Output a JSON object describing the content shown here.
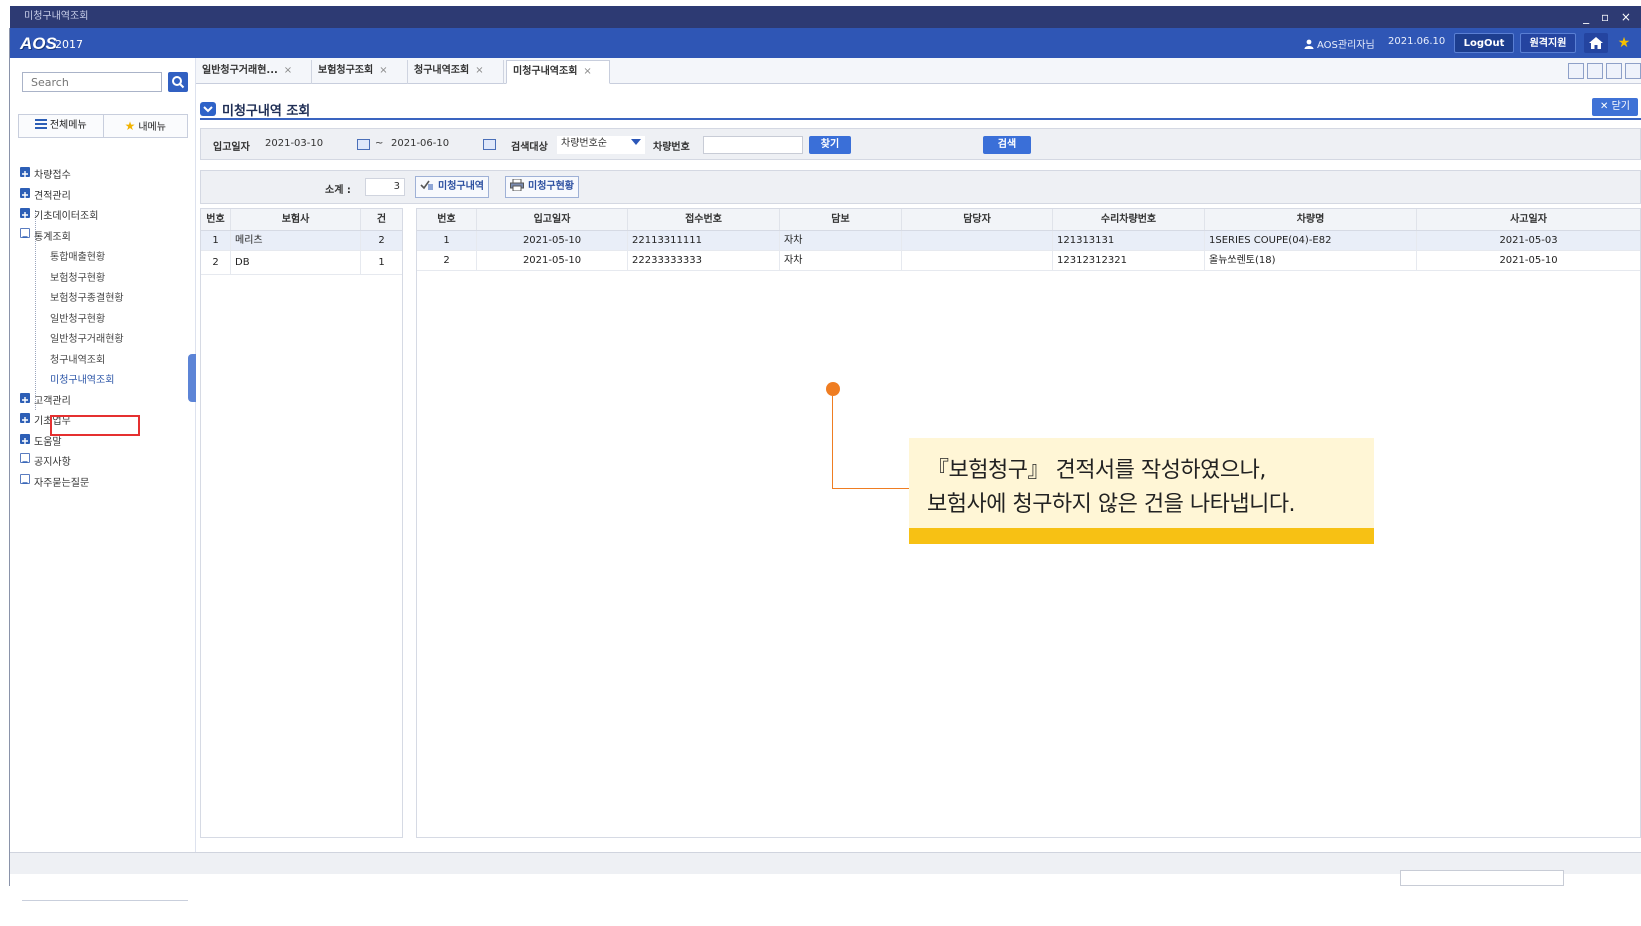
{
  "window": {
    "title": "미청구내역조회",
    "controls": "_ ▫ ×"
  },
  "appbar": {
    "logo": "AOS",
    "logo_year": "2017",
    "user": "AOS관리자님",
    "date": "2021.06.10",
    "logout_label": "LogOut",
    "remote_label": "원격지원"
  },
  "sidebar": {
    "search_placeholder": "Search",
    "menu_tab_all": "전체메뉴",
    "menu_tab_my": "내메뉴",
    "tree": [
      {
        "label": "차량접수",
        "type": "plus"
      },
      {
        "label": "견적관리",
        "type": "plus"
      },
      {
        "label": "기초데이터조회",
        "type": "plus"
      },
      {
        "label": "통계조회",
        "type": "minus"
      },
      {
        "label": "통합매출현황",
        "type": "child"
      },
      {
        "label": "보험청구현황",
        "type": "child"
      },
      {
        "label": "보험청구종결현황",
        "type": "child"
      },
      {
        "label": "일반청구현황",
        "type": "child"
      },
      {
        "label": "일반청구거래현황",
        "type": "child"
      },
      {
        "label": "청구내역조회",
        "type": "child"
      },
      {
        "label": "미청구내역조회",
        "type": "child-selected"
      },
      {
        "label": "고객관리",
        "type": "plus"
      },
      {
        "label": "기초업무",
        "type": "plus"
      },
      {
        "label": "도움말",
        "type": "plus"
      },
      {
        "label": "공지사항",
        "type": "minus"
      },
      {
        "label": "자주묻는질문",
        "type": "minus"
      }
    ]
  },
  "tabs": [
    {
      "label": "일반청구거래현...",
      "close": "×"
    },
    {
      "label": "보험청구조회",
      "close": "×"
    },
    {
      "label": "청구내역조회",
      "close": "×"
    },
    {
      "label": "미청구내역조회",
      "close": "×"
    }
  ],
  "page": {
    "title": "미청구내역 조회",
    "close_label": "✕ 닫기"
  },
  "filter": {
    "date_label": "입고일자",
    "date_from": "2021-03-10",
    "date_sep": "~",
    "date_to": "2021-06-10",
    "target_label": "검색대상",
    "target_value": "차량번호순",
    "carno_label": "차량번호",
    "carno_value": "",
    "find_label": "찾기",
    "search_label": "검색"
  },
  "summary": {
    "label": "소계 :",
    "value": "3",
    "btn_unclaimed_list": "미청구내역",
    "btn_unclaimed_status": "미청구현황"
  },
  "left_table": {
    "headers": [
      "번호",
      "보험사",
      "건"
    ],
    "rows": [
      [
        "1",
        "메리츠",
        "2"
      ],
      [
        "2",
        "DB",
        "1"
      ]
    ]
  },
  "right_table": {
    "headers": [
      "번호",
      "입고일자",
      "접수번호",
      "담보",
      "담당자",
      "수리차량번호",
      "차량명",
      "사고일자"
    ],
    "rows": [
      [
        "1",
        "2021-05-10",
        "22113311111",
        "자차",
        "",
        "121313131",
        "1SERIES COUPE(04)-E82",
        "2021-05-03"
      ],
      [
        "2",
        "2021-05-10",
        "22233333333",
        "자차",
        "",
        "12312312321",
        "올뉴쏘렌토(18)",
        "2021-05-10"
      ]
    ]
  },
  "callout": {
    "line1": "『보험청구』 견적서를 작성하였으나,",
    "line2": "보험사에 청구하지 않은 건을 나타냅니다."
  },
  "colors": {
    "titlebar": "#2d3a73",
    "appbar": "#2f56b5",
    "accent": "#3a6fd8",
    "selection_outline": "#e53030",
    "callout_dot": "#ef7d22",
    "callout_bg": "#fff6d6",
    "callout_bar": "#f7c114"
  },
  "icons": {
    "search": "search-icon",
    "menu": "hamburger-icon",
    "favorite": "star-icon",
    "home": "home-icon",
    "user": "user-icon",
    "calendar": "calendar-icon",
    "list": "checklist-icon",
    "print": "printer-icon"
  }
}
